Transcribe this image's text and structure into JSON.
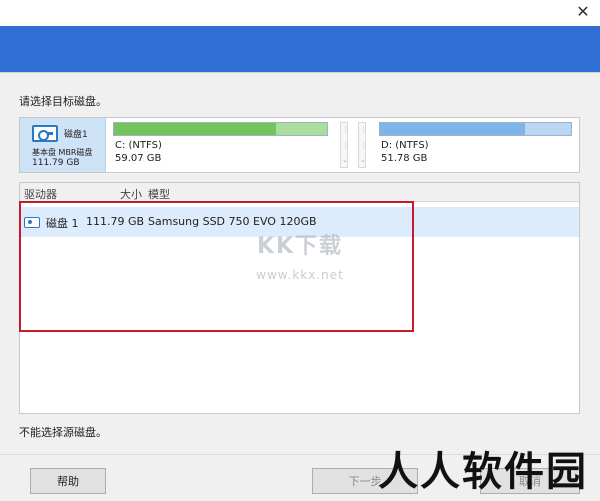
{
  "window": {
    "close_glyph": "✕",
    "accent": "#2f6fd3"
  },
  "prompt": "请选择目标磁盘。",
  "disk_map": {
    "disk_name": "磁盘1",
    "disk_type": "基本盘 MBR磁盘",
    "disk_size": "111.79 GB",
    "partitions": [
      {
        "name": "C: (NTFS)",
        "size": "59.07 GB",
        "used_fraction": 0.76,
        "color": "#74c45b",
        "bg": "#a9df9a"
      },
      {
        "name": "D: (NTFS)",
        "size": "51.78 GB",
        "used_fraction": 0.76,
        "color": "#7fb4eb",
        "bg": "#b9d7f5"
      }
    ]
  },
  "list": {
    "headers": {
      "drive": "驱动器",
      "size": "大小",
      "model": "模型"
    },
    "rows": [
      {
        "drive": "磁盘 1",
        "size": "111.79 GB",
        "model": "Samsung SSD 750 EVO 120GB"
      }
    ]
  },
  "watermark": {
    "title": "KK下载",
    "url": "www.kkx.net"
  },
  "note": "不能选择源磁盘。",
  "buttons": {
    "help": "帮助",
    "next": "下一步",
    "cancel": "取消"
  },
  "brand_watermark": "人人软件园"
}
